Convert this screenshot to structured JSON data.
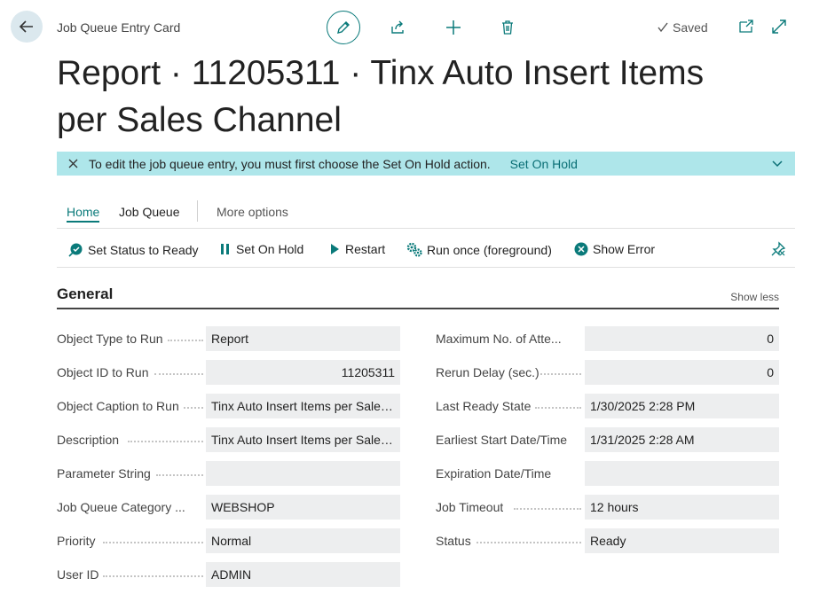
{
  "breadcrumb": "Job Queue Entry Card",
  "status": {
    "saved_label": "Saved"
  },
  "title": "Report · 11205311 · Tinx Auto Insert Items per Sales Channel",
  "banner": {
    "message": "To edit the job queue entry, you must first choose the Set On Hold action.",
    "action_label": "Set On Hold"
  },
  "tabs": [
    {
      "label": "Home"
    },
    {
      "label": "Job Queue"
    },
    {
      "label": "More options"
    }
  ],
  "actions": [
    {
      "label": "Set Status to Ready",
      "icon": "ready-icon"
    },
    {
      "label": "Set On Hold",
      "icon": "pause-icon"
    },
    {
      "label": "Restart",
      "icon": "play-icon"
    },
    {
      "label": "Run once (foreground)",
      "icon": "gears-icon"
    },
    {
      "label": "Show Error",
      "icon": "error-icon"
    }
  ],
  "section": {
    "title": "General",
    "toggle_label": "Show less"
  },
  "left_fields": [
    {
      "label": "Object Type to Run",
      "value": "Report"
    },
    {
      "label": "Object ID to Run",
      "value": "11205311"
    },
    {
      "label": "Object Caption to Run",
      "value": "Tinx Auto Insert Items per Sales ..."
    },
    {
      "label": "Description",
      "value": "Tinx Auto Insert Items per Sales ..."
    },
    {
      "label": "Parameter String",
      "value": ""
    },
    {
      "label": "Job Queue Category ...",
      "value": "WEBSHOP"
    },
    {
      "label": "Priority",
      "value": "Normal"
    },
    {
      "label": "User ID",
      "value": "ADMIN"
    }
  ],
  "right_fields": [
    {
      "label": "Maximum No. of Atte...",
      "value": "0"
    },
    {
      "label": "Rerun Delay (sec.)",
      "value": "0"
    },
    {
      "label": "Last Ready State",
      "value": "1/30/2025 2:28 PM"
    },
    {
      "label": "Earliest Start Date/Time",
      "value": "1/31/2025 2:28 AM"
    },
    {
      "label": "Expiration Date/Time",
      "value": ""
    },
    {
      "label": "Job Timeout",
      "value": "12 hours"
    },
    {
      "label": "Status",
      "value": "Ready"
    }
  ],
  "colors": {
    "accent": "#0a7a7a",
    "banner": "#aee6ea",
    "field_bg": "#edeeef"
  }
}
